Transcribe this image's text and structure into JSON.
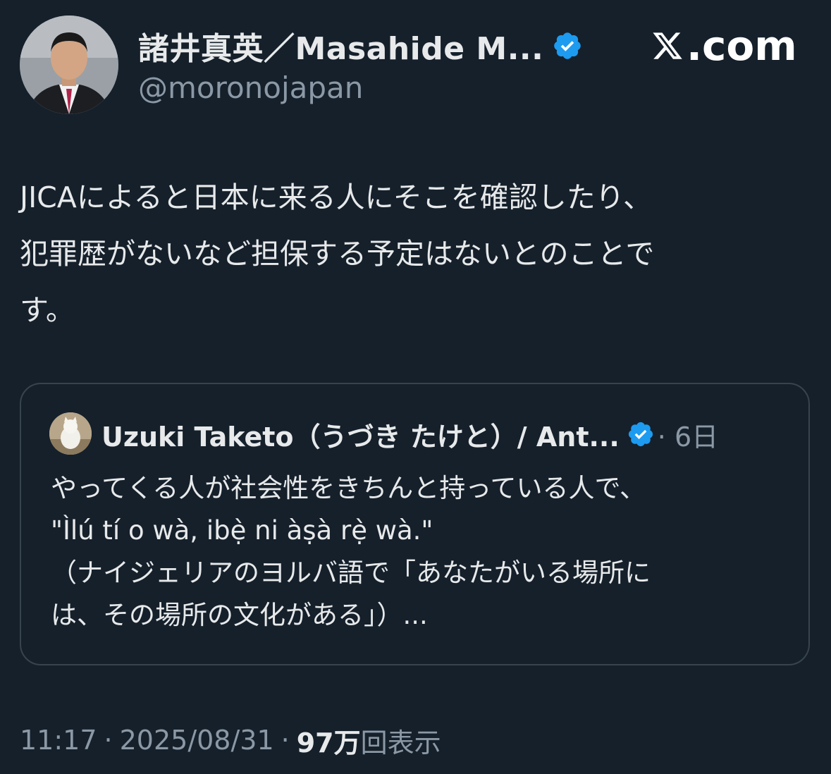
{
  "author": {
    "display_name": "諸井真英／Masahide M...",
    "handle": "@moronojapan",
    "verified": true
  },
  "site_mark": ".com",
  "tweet": {
    "text": "JICAによると日本に来る人にそこを確認したり、\n犯罪歴がないなど担保する予定はないとのことで\nす。"
  },
  "quote": {
    "display_name": "Uzuki Taketo（うづき たけと）/ Ant...",
    "verified": true,
    "time": "· 6日",
    "text": "やってくる人が社会性をきちんと持っている人で、\n\"Ìlú tí o wà, ibẹ̀ ni àṣà rẹ̀ wà.\"\n（ナイジェリアのヨルバ語で「あなたがいる場所に\nは、その場所の文化がある」）..."
  },
  "meta": {
    "time": "11:17",
    "date": "2025/08/31",
    "views_count": "97万",
    "views_label": "回表示"
  },
  "colors": {
    "background": "#15202b",
    "text": "#e7e9ea",
    "muted": "#8b98a5",
    "verified_blue": "#1d9bf0",
    "card_border": "#38444d"
  },
  "icons": {
    "verified": "verified-badge-icon",
    "x_logo": "x-logo-icon"
  }
}
